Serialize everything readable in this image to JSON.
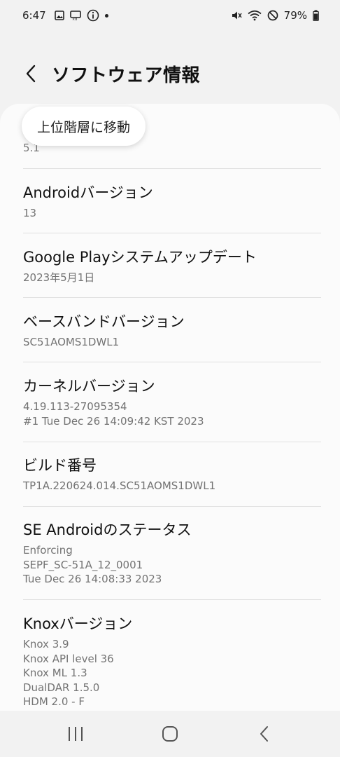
{
  "status_bar": {
    "time": "6:47",
    "battery": "79%",
    "icons_left": [
      "gallery-icon",
      "screen-record-icon",
      "info-icon",
      "dot-icon"
    ],
    "icons_right": [
      "mute-icon",
      "wifi-icon",
      "do-not-disturb-icon",
      "battery-icon"
    ]
  },
  "header": {
    "title": "ソフトウェア情報"
  },
  "scroll_top_chip": {
    "label": "上位階層に移動"
  },
  "first_partial_value": "5.1",
  "items": [
    {
      "title": "Androidバージョン",
      "values": [
        "13"
      ]
    },
    {
      "title": "Google Playシステムアップデート",
      "values": [
        "2023年5月1日"
      ]
    },
    {
      "title": "ベースバンドバージョン",
      "values": [
        "SC51AOMS1DWL1"
      ]
    },
    {
      "title": "カーネルバージョン",
      "values": [
        "4.19.113-27095354",
        "#1 Tue Dec 26 14:09:42 KST 2023"
      ]
    },
    {
      "title": "ビルド番号",
      "values": [
        "TP1A.220624.014.SC51AOMS1DWL1"
      ]
    },
    {
      "title": "SE Androidのステータス",
      "values": [
        "Enforcing",
        "SEPF_SC-51A_12_0001",
        "Tue Dec 26 14:08:33 2023"
      ]
    },
    {
      "title": "Knoxバージョン",
      "values": [
        "Knox 3.9",
        "Knox API level 36",
        "Knox ML 1.3",
        "DualDAR 1.5.0",
        "HDM 2.0 - F"
      ]
    }
  ],
  "nav": [
    "recent-apps-icon",
    "home-icon",
    "back-icon"
  ],
  "colors": {
    "background": "#f2f2f2",
    "card": "#fbfbfb",
    "secondary_text": "#737373"
  }
}
